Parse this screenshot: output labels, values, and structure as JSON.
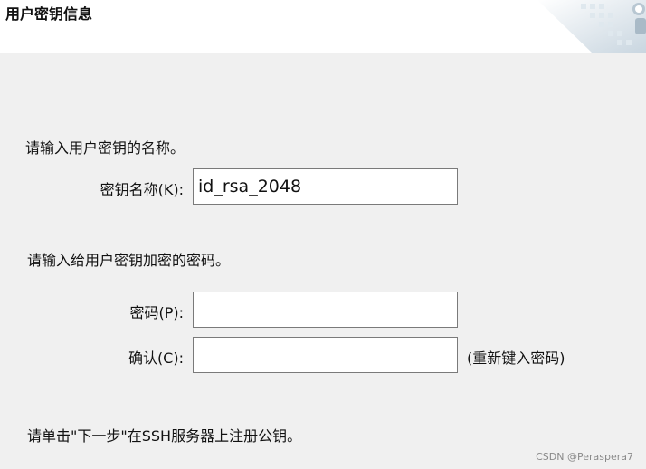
{
  "header": {
    "title": "用户密钥信息"
  },
  "prompt_name": "请输入用户密钥的名称。",
  "key_name": {
    "label": "密钥名称(K):",
    "value": "id_rsa_2048"
  },
  "prompt_password": "请输入给用户密钥加密的密码。",
  "password": {
    "label": "密码(P):",
    "value": ""
  },
  "confirm": {
    "label": "确认(C):",
    "value": "",
    "hint": "(重新键入密码)"
  },
  "footer_note": "请单击\"下一步\"在SSH服务器上注册公钥。",
  "watermark": "CSDN @Peraspera7"
}
